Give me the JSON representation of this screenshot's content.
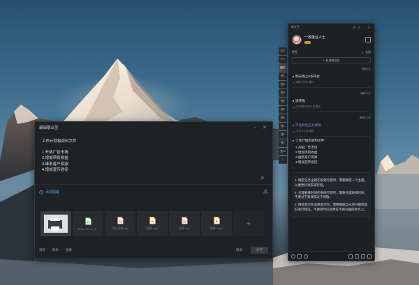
{
  "editor": {
    "title": "编辑敬业签",
    "content_lines": [
      "工作计划和资料文件",
      "",
      "1.开拓广告市场",
      "2.增加项目收益",
      "3.维系客户资源",
      "4.增加宣传途径"
    ],
    "reminder_label": "添加提醒",
    "attachments": [
      {
        "caption": "",
        "kind": "photo"
      },
      {
        "caption": "2024_08_11_1...",
        "kind": "file-green"
      },
      {
        "caption": "项目资料.doc",
        "kind": "file-red"
      },
      {
        "caption": "视频.mp4",
        "kind": "file-orange"
      },
      {
        "caption": "文件.doc",
        "kind": "file-red"
      },
      {
        "caption": "视频2.mp4",
        "kind": "file-orange"
      },
      {
        "caption": "+",
        "kind": "add"
      }
    ],
    "toolbar": [
      "日程",
      "颜色",
      "画板"
    ],
    "cancel_label": "取消",
    "save_label": "保存"
  },
  "side_tabs": [
    "文字",
    "个人",
    "团队",
    "签1",
    "签2",
    "签3",
    "签4",
    "签5",
    "签6",
    "签7",
    "签8",
    "签9",
    "签10",
    "+"
  ],
  "panel": {
    "app_name": "敬业签",
    "username": "一枚敬业人士",
    "vip_badge": "VIP",
    "filter_label": "便签",
    "filter_all": "全部",
    "new_note_label": "新建敬业签",
    "notes": [
      {
        "time": "编辑1天",
        "title": "明天晚上6点开会",
        "meta": "明天 18:00 周六",
        "purple": false
      },
      {
        "time": "编辑27天",
        "title": "送花啦",
        "meta": "2025年09月29日 周五",
        "purple": false
      },
      {
        "time": "编辑2小时",
        "title": "评估风险应对事项",
        "meta": "今天 12:45 周四",
        "purple": true
      }
    ],
    "open_note": {
      "title": "工作计划和资料文件",
      "lines": [
        "1.开拓广告市场",
        "2.增加项目收益",
        "3.维系客户资源",
        "4.增加宣传途径"
      ]
    },
    "long_note": [
      "1. 确定任务主题在规划行程时，需要确定一个主题，以便更好地安排行程。",
      "2. 合理安排时间在安排行程时，需要合理安排时间，不要过于紧凑或过于闲散。",
      "3. 精选景点在选择景点时，需要根据自己的兴趣和喜好进行精选，不要将时间浪费在不感兴趣的景点上。"
    ]
  },
  "colors": {
    "accent": "#4b9fe0",
    "vip": "#e0a72c",
    "panel_bg": "#1e2124",
    "purple": "#9d7df0"
  }
}
